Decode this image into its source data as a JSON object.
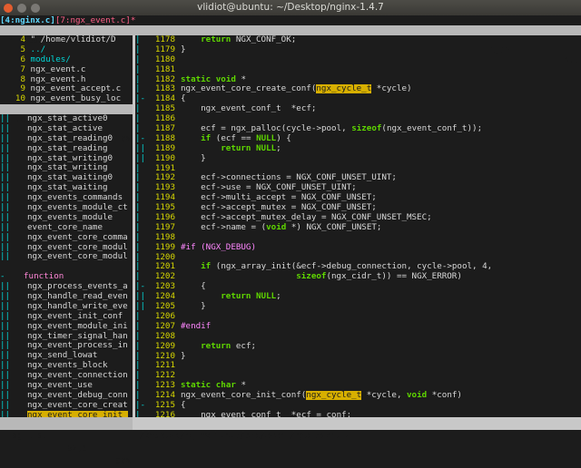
{
  "window": {
    "title": "vlidiot@ubuntu: ~/Desktop/nginx-1.4.7"
  },
  "tabline": {
    "active_tab": "[4:nginx.c]",
    "inactive_tab": "[7:ngx_event.c]",
    "modified_marker": "*"
  },
  "minibuf": {
    "name": "-MiniBufExplorer-",
    "position": "1,12",
    "scroll": "All"
  },
  "file_list": {
    "rows": [
      {
        "num": "4",
        "text": "\" /home/vlidiot/D",
        "cls": "code"
      },
      {
        "num": "5",
        "text": "../",
        "cls": "cyan"
      },
      {
        "num": "6",
        "text": "modules/",
        "cls": "cyan"
      },
      {
        "num": "7",
        "text": "ngx_event.c",
        "cls": "code"
      },
      {
        "num": "8",
        "text": "ngx_event.h",
        "cls": "code"
      },
      {
        "num": "9",
        "text": "ngx_event_accept.c",
        "cls": "code"
      },
      {
        "num": "10",
        "text": "ngx_event_busy_loc",
        "cls": "code"
      }
    ],
    "status_name": "[File List]",
    "status_pos": "7,1",
    "status_pct": "18%"
  },
  "tag_list": {
    "items": [
      {
        "gutter": "||",
        "text": "ngx_stat_active0"
      },
      {
        "gutter": "||",
        "text": "ngx_stat_active"
      },
      {
        "gutter": "||",
        "text": "ngx_stat_reading0"
      },
      {
        "gutter": "||",
        "text": "ngx_stat_reading"
      },
      {
        "gutter": "||",
        "text": "ngx_stat_writing0"
      },
      {
        "gutter": "||",
        "text": "ngx_stat_writing"
      },
      {
        "gutter": "||",
        "text": "ngx_stat_waiting0"
      },
      {
        "gutter": "||",
        "text": "ngx_stat_waiting"
      },
      {
        "gutter": "||",
        "text": "ngx_events_commands"
      },
      {
        "gutter": "||",
        "text": "ngx_events_module_ct"
      },
      {
        "gutter": "||",
        "text": "ngx_events_module"
      },
      {
        "gutter": "||",
        "text": "event_core_name"
      },
      {
        "gutter": "||",
        "text": "ngx_event_core_comma"
      },
      {
        "gutter": "||",
        "text": "ngx_event_core_modul"
      },
      {
        "gutter": "||",
        "text": "ngx_event_core_modul"
      },
      {
        "gutter": "",
        "text": ""
      },
      {
        "gutter": "-",
        "text": "function",
        "heading": true
      },
      {
        "gutter": "||",
        "text": "ngx_process_events_a"
      },
      {
        "gutter": "||",
        "text": "ngx_handle_read_even"
      },
      {
        "gutter": "||",
        "text": "ngx_handle_write_eve"
      },
      {
        "gutter": "||",
        "text": "ngx_event_init_conf"
      },
      {
        "gutter": "||",
        "text": "ngx_event_module_ini"
      },
      {
        "gutter": "||",
        "text": "ngx_timer_signal_han"
      },
      {
        "gutter": "||",
        "text": "ngx_event_process_in"
      },
      {
        "gutter": "||",
        "text": "ngx_send_lowat"
      },
      {
        "gutter": "||",
        "text": "ngx_events_block"
      },
      {
        "gutter": "||",
        "text": "ngx_event_connection"
      },
      {
        "gutter": "||",
        "text": "ngx_event_use"
      },
      {
        "gutter": "||",
        "text": "ngx_event_debug_conn"
      },
      {
        "gutter": "||",
        "text": "ngx_event_core_creat"
      },
      {
        "gutter": "||",
        "text": "ngx_event_core_init_",
        "selected": true
      }
    ],
    "status_name": "_Tag_List_",
    "status_pos": "92,5",
    "status_pct": "98%"
  },
  "editor": {
    "lines": [
      {
        "g": "|",
        "n": "1178",
        "t": "    return NGX_CONF_OK;"
      },
      {
        "g": "|",
        "n": "1179",
        "t": "}"
      },
      {
        "g": "|",
        "n": "1180",
        "t": ""
      },
      {
        "g": "|",
        "n": "1181",
        "t": ""
      },
      {
        "g": "|",
        "n": "1182",
        "t": "static void *"
      },
      {
        "g": "|",
        "n": "1183",
        "t": "ngx_event_core_create_conf(ngx_cycle_t *cycle)"
      },
      {
        "g": "|-",
        "n": "1184",
        "t": "{"
      },
      {
        "g": "|",
        "n": "1185",
        "t": "    ngx_event_conf_t  *ecf;"
      },
      {
        "g": "|",
        "n": "1186",
        "t": ""
      },
      {
        "g": "|",
        "n": "1187",
        "t": "    ecf = ngx_palloc(cycle->pool, sizeof(ngx_event_conf_t));"
      },
      {
        "g": "|-",
        "n": "1188",
        "t": "    if (ecf == NULL) {"
      },
      {
        "g": "||",
        "n": "1189",
        "t": "        return NULL;"
      },
      {
        "g": "||",
        "n": "1190",
        "t": "    }"
      },
      {
        "g": "|",
        "n": "1191",
        "t": ""
      },
      {
        "g": "|",
        "n": "1192",
        "t": "    ecf->connections = NGX_CONF_UNSET_UINT;"
      },
      {
        "g": "|",
        "n": "1193",
        "t": "    ecf->use = NGX_CONF_UNSET_UINT;"
      },
      {
        "g": "|",
        "n": "1194",
        "t": "    ecf->multi_accept = NGX_CONF_UNSET;"
      },
      {
        "g": "|",
        "n": "1195",
        "t": "    ecf->accept_mutex = NGX_CONF_UNSET;"
      },
      {
        "g": "|",
        "n": "1196",
        "t": "    ecf->accept_mutex_delay = NGX_CONF_UNSET_MSEC;"
      },
      {
        "g": "|",
        "n": "1197",
        "t": "    ecf->name = (void *) NGX_CONF_UNSET;"
      },
      {
        "g": "|",
        "n": "1198",
        "t": ""
      },
      {
        "g": "|",
        "n": "1199",
        "t": "#if (NGX_DEBUG)"
      },
      {
        "g": "|",
        "n": "1200",
        "t": ""
      },
      {
        "g": "|",
        "n": "1201",
        "t": "    if (ngx_array_init(&ecf->debug_connection, cycle->pool, 4,"
      },
      {
        "g": "|",
        "n": "1202",
        "t": "                       sizeof(ngx_cidr_t)) == NGX_ERROR)"
      },
      {
        "g": "|-",
        "n": "1203",
        "t": "    {"
      },
      {
        "g": "||",
        "n": "1204",
        "t": "        return NULL;"
      },
      {
        "g": "||",
        "n": "1205",
        "t": "    }"
      },
      {
        "g": "|",
        "n": "1206",
        "t": ""
      },
      {
        "g": "|",
        "n": "1207",
        "t": "#endif"
      },
      {
        "g": "|",
        "n": "1208",
        "t": ""
      },
      {
        "g": "|",
        "n": "1209",
        "t": "    return ecf;"
      },
      {
        "g": "|",
        "n": "1210",
        "t": "}"
      },
      {
        "g": "|",
        "n": "1211",
        "t": ""
      },
      {
        "g": "|",
        "n": "1212",
        "t": ""
      },
      {
        "g": "|",
        "n": "1213",
        "t": "static char *"
      },
      {
        "g": "|",
        "n": "1214",
        "t": "ngx_event_core_init_conf(ngx_cycle_t *cycle, void *conf)"
      },
      {
        "g": "|-",
        "n": "1215",
        "t": "{"
      },
      {
        "g": "|",
        "n": "1216",
        "t": "    ngx_event_conf_t  *ecf = conf;"
      }
    ]
  },
  "status": {
    "path": "~/Desktop/nginx-1.4.7/src/event/ngx_event.c"
  }
}
